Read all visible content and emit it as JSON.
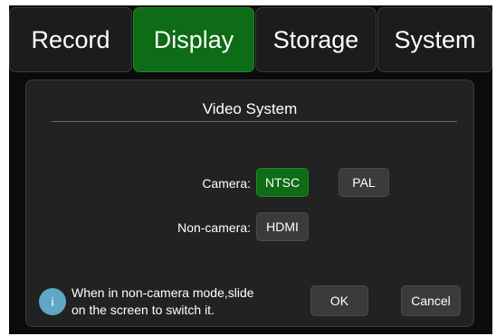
{
  "tabs": [
    {
      "label": "Record",
      "active": false
    },
    {
      "label": "Display",
      "active": true
    },
    {
      "label": "Storage",
      "active": false
    },
    {
      "label": "System",
      "active": false
    }
  ],
  "dialog": {
    "title": "Video System",
    "camera_label": "Camera:",
    "camera_options": [
      {
        "label": "NTSC",
        "selected": true
      },
      {
        "label": "PAL",
        "selected": false
      }
    ],
    "noncamera_label": "Non-camera:",
    "noncamera_option": {
      "label": "HDMI",
      "selected": false
    },
    "info_icon_glyph": "i",
    "info_text_line1": "When in non-camera mode,slide",
    "info_text_line2": "on the screen to switch it.",
    "ok_label": "OK",
    "cancel_label": "Cancel"
  },
  "colors": {
    "accent": "#0e6b16",
    "background": "#0b0b0b",
    "panel": "#222222",
    "info_icon": "#5fa7c4"
  }
}
